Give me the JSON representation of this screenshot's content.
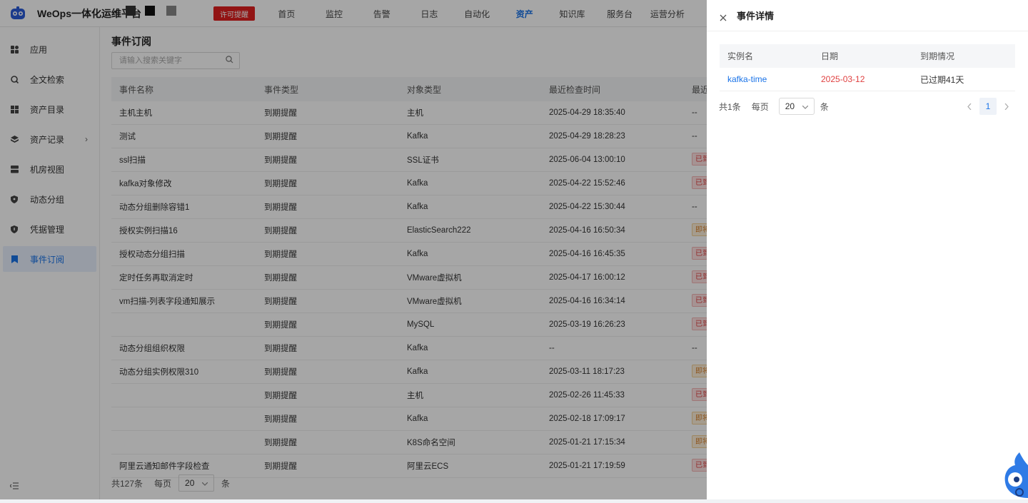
{
  "header": {
    "brand": "WeOps一体化运维平台",
    "license_badge": "许可提醒",
    "nav": [
      "首页",
      "监控",
      "告警",
      "日志",
      "自动化",
      "资产",
      "知识库",
      "服务台",
      "运营分析"
    ],
    "active_nav": "资产"
  },
  "sidebar": {
    "items": [
      {
        "label": "应用",
        "icon": "grid-icon"
      },
      {
        "label": "全文检索",
        "icon": "search-globe-icon"
      },
      {
        "label": "资产目录",
        "icon": "catalog-icon"
      },
      {
        "label": "资产记录",
        "icon": "layers-icon",
        "chevron": "›"
      },
      {
        "label": "机房视图",
        "icon": "server-icon"
      },
      {
        "label": "动态分组",
        "icon": "shield-icon"
      },
      {
        "label": "凭据管理",
        "icon": "key-shield-icon"
      },
      {
        "label": "事件订阅",
        "icon": "bookmark-icon"
      }
    ],
    "active": "事件订阅"
  },
  "main": {
    "title": "事件订阅",
    "search_placeholder": "请输入搜索关键字",
    "columns": [
      "事件名称",
      "事件类型",
      "对象类型",
      "最近检查时间",
      "最近"
    ],
    "rows": [
      {
        "name": "主机主机",
        "type": "到期提醒",
        "object": "主机",
        "time": "2025-04-29 18:35:40",
        "status": "--",
        "status_kind": "text"
      },
      {
        "name": "测试",
        "type": "到期提醒",
        "object": "Kafka",
        "time": "2025-04-29 18:28:23",
        "status": "--",
        "status_kind": "text"
      },
      {
        "name": "ssl扫描",
        "type": "到期提醒",
        "object": "SSL证书",
        "time": "2025-06-04 13:00:10",
        "status": "已到期",
        "status_kind": "red"
      },
      {
        "name": "kafka对象修改",
        "type": "到期提醒",
        "object": "Kafka",
        "time": "2025-04-22 15:52:46",
        "status": "已到期",
        "status_kind": "red"
      },
      {
        "name": "动态分组删除容错1",
        "type": "到期提醒",
        "object": "Kafka",
        "time": "2025-04-22 15:30:44",
        "status": "--",
        "status_kind": "text"
      },
      {
        "name": "授权实例扫描16",
        "type": "到期提醒",
        "object": "ElasticSearch222",
        "time": "2025-04-16 16:50:34",
        "status": "即将到期",
        "status_kind": "orange"
      },
      {
        "name": "授权动态分组扫描",
        "type": "到期提醒",
        "object": "Kafka",
        "time": "2025-04-16 16:45:35",
        "status": "已到期",
        "status_kind": "red"
      },
      {
        "name": "定时任务再取消定时",
        "type": "到期提醒",
        "object": "VMware虚拟机",
        "time": "2025-04-17 16:00:12",
        "status": "已到期",
        "status_kind": "red"
      },
      {
        "name": "vm扫描-列表字段通知展示",
        "type": "到期提醒",
        "object": "VMware虚拟机",
        "time": "2025-04-16 16:34:14",
        "status": "已到期",
        "status_kind": "red"
      },
      {
        "name": "",
        "type": "到期提醒",
        "object": "MySQL",
        "time": "2025-03-19 16:26:23",
        "status": "已到期",
        "status_kind": "red",
        "blurred": true
      },
      {
        "name": "动态分组组织权限",
        "type": "到期提醒",
        "object": "Kafka",
        "time": "--",
        "status": "--",
        "status_kind": "text"
      },
      {
        "name": "动态分组实例权限310",
        "type": "到期提醒",
        "object": "Kafka",
        "time": "2025-03-11 18:17:23",
        "status": "即将到期",
        "status_kind": "orange"
      },
      {
        "name": "",
        "type": "到期提醒",
        "object": "主机",
        "time": "2025-02-26 11:45:33",
        "status": "已到期",
        "status_kind": "red",
        "blurred": true
      },
      {
        "name": "",
        "type": "到期提醒",
        "object": "Kafka",
        "time": "2025-02-18 17:09:17",
        "status": "即将到期",
        "status_kind": "orange",
        "blurred": true
      },
      {
        "name": "",
        "type": "到期提醒",
        "object": "K8S命名空间",
        "time": "2025-01-21 17:15:34",
        "status": "即将到期",
        "status_kind": "orange",
        "blurred": true
      },
      {
        "name": "阿里云通知邮件字段检查",
        "type": "到期提醒",
        "object": "阿里云ECS",
        "time": "2025-01-21 17:19:59",
        "status": "已到期",
        "status_kind": "red"
      }
    ],
    "footer": {
      "total": "共127条",
      "per_page_label": "每页",
      "per_page": "20",
      "unit": "条"
    }
  },
  "drawer": {
    "title": "事件详情",
    "columns": [
      "实例名",
      "日期",
      "到期情况"
    ],
    "rows": [
      {
        "instance": "kafka-time",
        "date": "2025-03-12",
        "status": "已过期41天"
      }
    ],
    "footer": {
      "total": "共1条",
      "per_page_label": "每页",
      "per_page": "20",
      "unit": "条",
      "page": "1"
    }
  },
  "colors": {
    "accent": "#1a73e8",
    "danger": "#e04040",
    "warning": "#d9822b"
  }
}
